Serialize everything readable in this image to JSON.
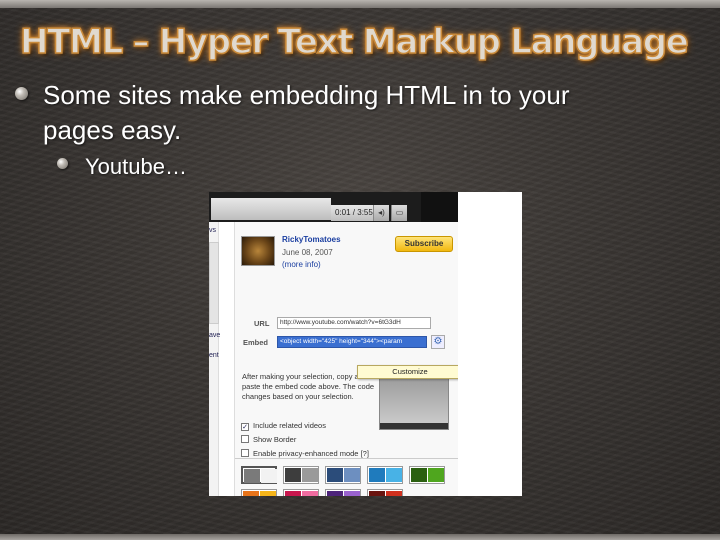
{
  "slide": {
    "title": "HTML – Hyper Text Markup Language",
    "bullet1_line1": "Some sites make embedding HTML in to your",
    "bullet1_line2": "pages easy.",
    "bullet2": "Youtube…"
  },
  "youtube": {
    "time": "0:01 / 3:55",
    "left_fragments": [
      "vs",
      "ave",
      "ent"
    ],
    "username": "RickyTomatoes",
    "date": "June 08, 2007",
    "more_info": "(more info)",
    "subscribe": "Subscribe",
    "url_label": "URL",
    "url_value": "http://www.youtube.com/watch?v=6tG3dH",
    "embed_label": "Embed",
    "embed_value": "<object width=\"425\" height=\"344\"><param",
    "customize": "Customize",
    "instructions": "After making your selection, copy and paste the embed code above. The code changes based on your selection.",
    "options": [
      {
        "label": "Include related videos",
        "checked": true
      },
      {
        "label": "Show Border",
        "checked": false
      },
      {
        "label": "Enable privacy-enhanced mode [?]",
        "checked": false
      }
    ],
    "swatches": [
      [
        "#7a7a7a",
        "#f2f2f2"
      ],
      [
        "#3d3d3d",
        "#9a9a9a"
      ],
      [
        "#2b4c7a",
        "#6d8fc0"
      ],
      [
        "#1f7bbd",
        "#48b2e6"
      ],
      [
        "#2b6010",
        "#4fa61e"
      ],
      [
        "#e8741a",
        "#f6b51a"
      ],
      [
        "#c8174e",
        "#f06ca0"
      ],
      [
        "#4d237a",
        "#9a62cf"
      ],
      [
        "#6a140f",
        "#d0301e"
      ]
    ]
  }
}
